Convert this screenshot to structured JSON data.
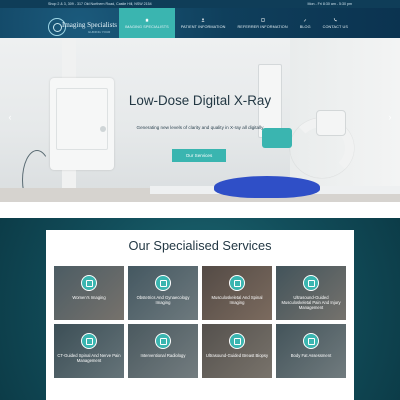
{
  "topbar": {
    "address": "Shop 2 & 3, 309 - 317 Old Northern Road, Castle Hill, NSW 2154",
    "hours": "Mon - Fri 8:30 am - 5:30 pm"
  },
  "logo": {
    "name": "Imaging Specialists",
    "tagline": "GUIDING YOUR"
  },
  "nav": {
    "items": [
      {
        "label": "IMAGING SPECIALISTS",
        "icon": "home-icon"
      },
      {
        "label": "PATIENT INFORMATION",
        "icon": "user-icon"
      },
      {
        "label": "REFERRER INFORMATION",
        "icon": "clipboard-icon"
      },
      {
        "label": "BLOG",
        "icon": "pen-icon"
      },
      {
        "label": "CONTACT US",
        "icon": "phone-icon"
      }
    ]
  },
  "hero": {
    "title": "Low-Dose Digital X-Ray",
    "subtitle": "Generating new levels of clarity and quality in X-ray all digitally",
    "button": "Our Services"
  },
  "services": {
    "title": "Our Specialised Services",
    "tiles": [
      {
        "label": "Women's Imaging"
      },
      {
        "label": "Obstetrics And Gynaecology Imaging"
      },
      {
        "label": "Musculoskeletal And Spinal Imaging"
      },
      {
        "label": "Ultrasound-Guided Musculoskeletal Pain And Injury Management"
      },
      {
        "label": "CT-Guided Spinal And Nerve Pain Management"
      },
      {
        "label": "Interventional Radiology"
      },
      {
        "label": "Ultrasound-Guided Breast Biopsy"
      },
      {
        "label": "Body Fat Assessment"
      }
    ]
  },
  "colors": {
    "accent": "#3ab5b0",
    "navy": "#0f3d58",
    "heading": "#233844"
  }
}
